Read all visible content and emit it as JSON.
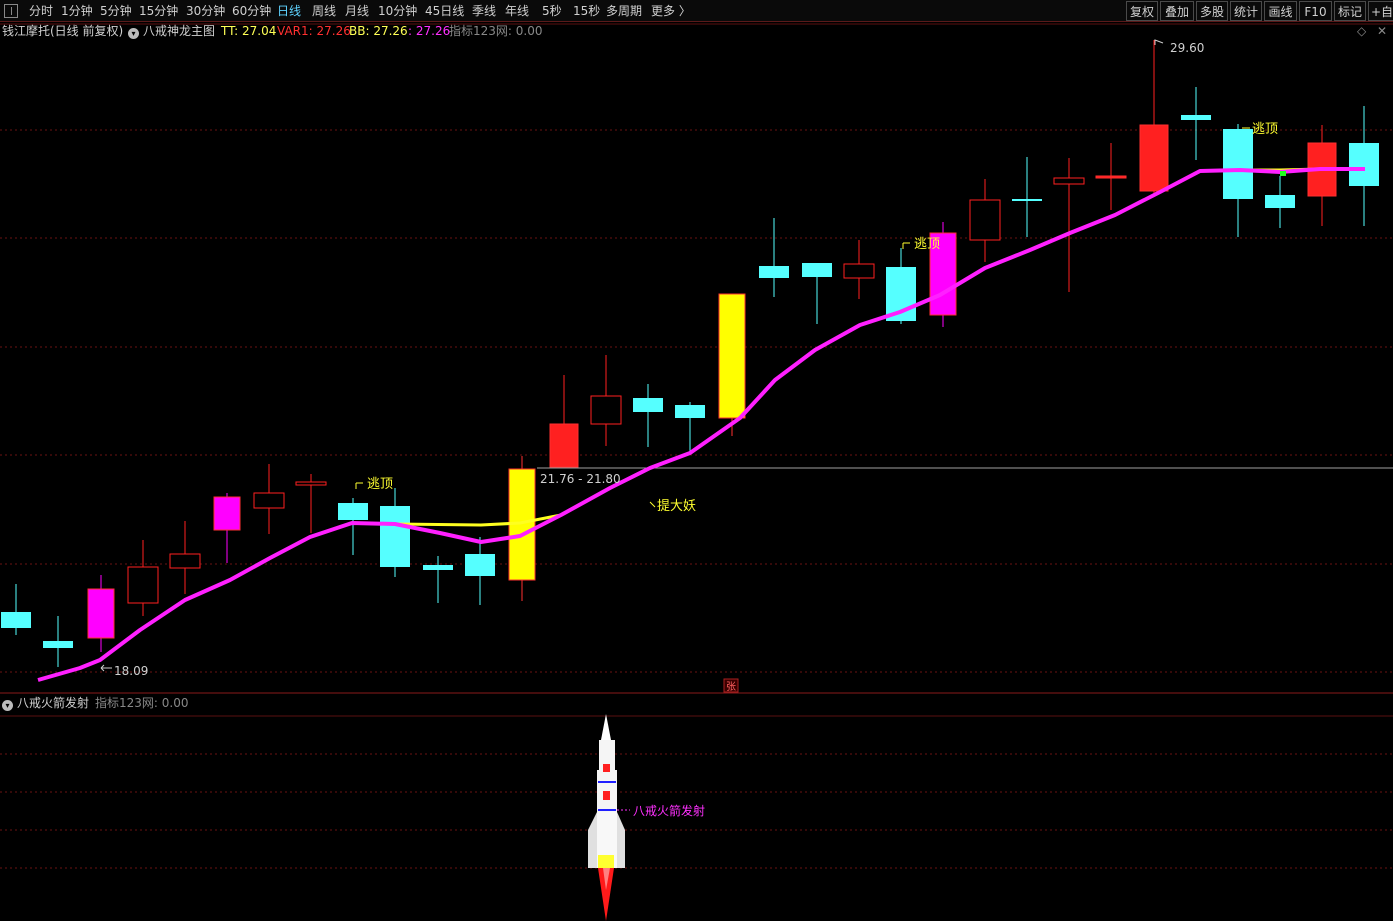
{
  "toolbar": {
    "periods": [
      "分时",
      "1分钟",
      "5分钟",
      "15分钟",
      "30分钟",
      "60分钟",
      "日线",
      "周线",
      "月线",
      "10分钟",
      "45日线",
      "季线",
      "年线",
      "5秒",
      "15秒",
      "多周期",
      "更多 〉"
    ],
    "active_period": "日线",
    "right_buttons": [
      "复权",
      "叠加",
      "多股",
      "统计",
      "画线",
      "F10",
      "标记",
      "+自"
    ]
  },
  "main_header": {
    "stock_title": "钱江摩托(日线 前复权)",
    "indicator_name": "八戒神龙主图",
    "tt_label": "TT: 27.04",
    "var1_label": "VAR1: 27.26",
    "bb_label": "BB: 27.26",
    "extra_label": ": 27.26",
    "net_label": "指标123网: 0.00",
    "menu_icon": "diamond-icon",
    "close_icon": "close-icon"
  },
  "main_chart": {
    "price_range": "21.76 - 21.80",
    "high_marker": "29.60",
    "low_marker": "18.09",
    "annotations": [
      "逃顶",
      "逃顶",
      "逃顶",
      "提大妖"
    ],
    "zhang_badge": "张"
  },
  "sub_header": {
    "indicator_name": "八戒火箭发射",
    "net_label": "指标123网: 0.00"
  },
  "sub_chart": {
    "rocket_label": "八戒火箭发射"
  },
  "colors": {
    "background": "#000000",
    "bull_candle": "#ff2020",
    "bear_candle": "#55ffff",
    "magenta_candle": "#ff00ff",
    "yellow_candle": "#ffff00",
    "ma_line": "#ff20ff",
    "grid": "#6a1212"
  }
}
